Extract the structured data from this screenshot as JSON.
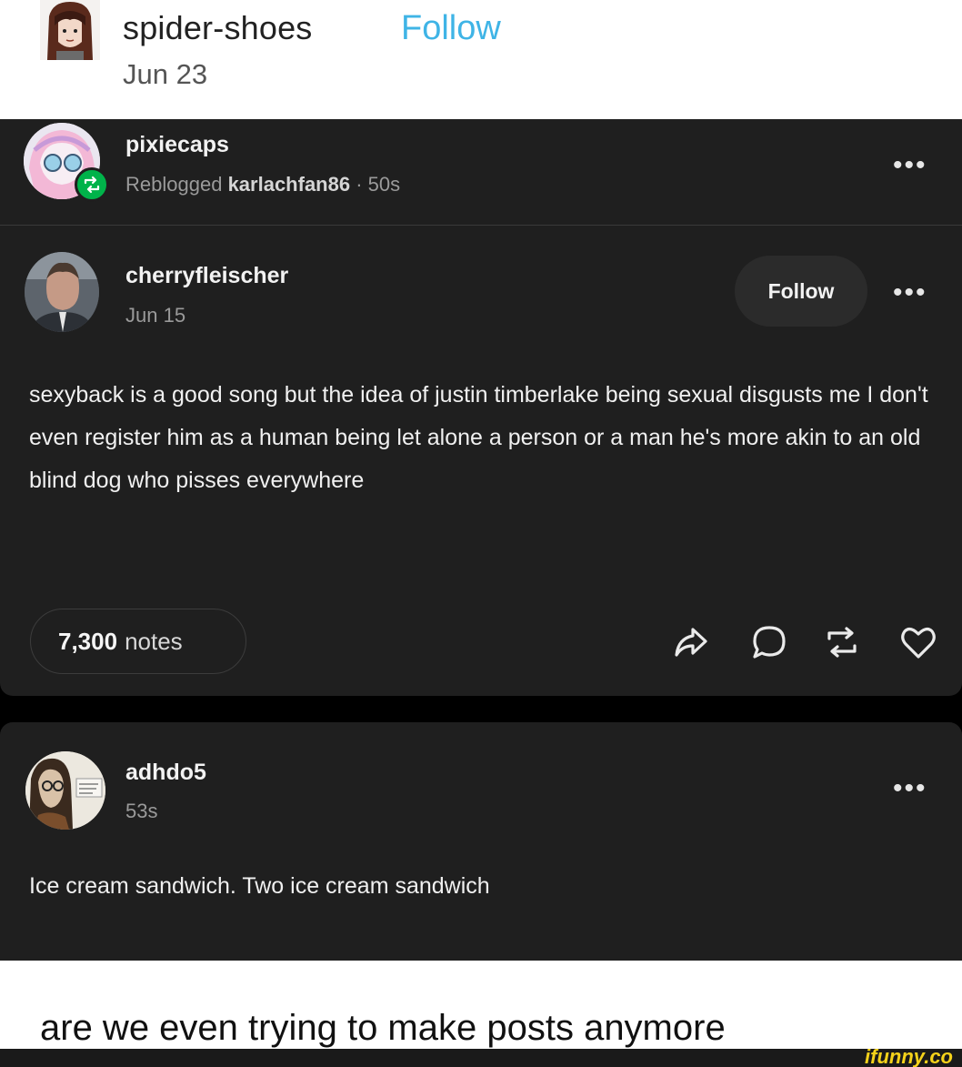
{
  "outer_post": {
    "username": "spider-shoes",
    "follow_label": "Follow",
    "date": "Jun 23"
  },
  "screenshot": {
    "reblog": {
      "username": "pixiecaps",
      "reblogged_label": "Reblogged",
      "source_user": "karlachfan86",
      "age": "· 50s"
    },
    "original": {
      "username": "cherryfleischer",
      "date": "Jun 15",
      "follow_label": "Follow",
      "body": "sexyback is a good song but the idea of justin timberlake being sexual disgusts me I don't even register him as a human being let alone a person or a man he's more akin to an old blind dog who pisses everywhere",
      "notes_count": "7,300",
      "notes_label": "notes"
    },
    "reply": {
      "username": "adhdo5",
      "age": "53s",
      "body": "Ice cream sandwich. Two ice cream sandwich"
    },
    "more_label": "•••"
  },
  "caption": "are we even trying to make posts anymore",
  "watermark": "ifunny.co",
  "colors": {
    "follow_blue": "#3fb4e6",
    "card_bg": "#1f1f1f",
    "reblog_green": "#00b34a",
    "watermark_yellow": "#f5d21a"
  },
  "icons": [
    "share-icon",
    "reply-icon",
    "reblog-icon",
    "like-icon",
    "more-icon"
  ]
}
